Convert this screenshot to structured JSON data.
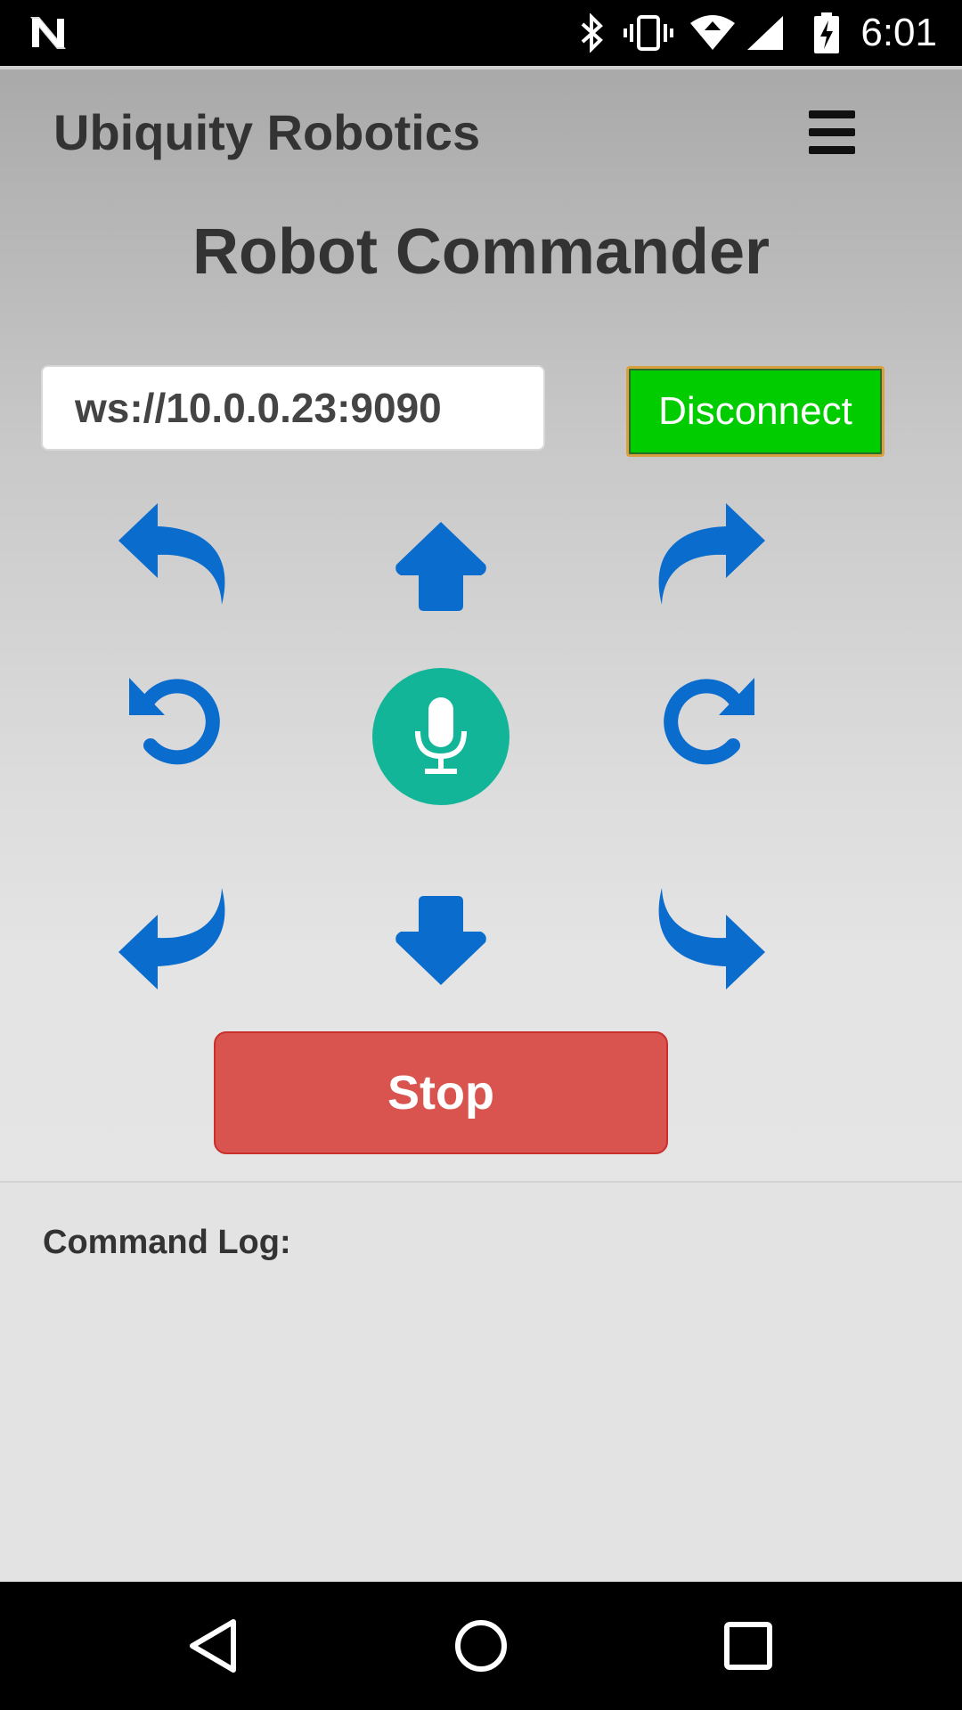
{
  "status_bar": {
    "time": "6:01",
    "icons": [
      "n-icon",
      "bluetooth-icon",
      "vibrate-icon",
      "wifi-icon",
      "signal-icon",
      "battery-charging-icon"
    ]
  },
  "header": {
    "brand": "Ubiquity Robotics",
    "menu_icon": "hamburger-menu-icon"
  },
  "main": {
    "title": "Robot Commander",
    "connection": {
      "url_value": "ws://10.0.0.23:9090",
      "button_label": "Disconnect"
    },
    "controls": [
      {
        "name": "forward-left",
        "icon": "curved-arrow-up-left-icon"
      },
      {
        "name": "forward",
        "icon": "arrow-up-icon"
      },
      {
        "name": "forward-right",
        "icon": "curved-arrow-up-right-icon"
      },
      {
        "name": "rotate-left",
        "icon": "rotate-ccw-icon"
      },
      {
        "name": "voice",
        "icon": "microphone-icon"
      },
      {
        "name": "rotate-right",
        "icon": "rotate-cw-icon"
      },
      {
        "name": "back-left",
        "icon": "curved-arrow-down-left-icon"
      },
      {
        "name": "back",
        "icon": "arrow-down-icon"
      },
      {
        "name": "back-right",
        "icon": "curved-arrow-down-right-icon"
      }
    ],
    "stop_label": "Stop"
  },
  "log": {
    "label": "Command Log:"
  },
  "colors": {
    "arrow_blue": "#0a6ccd",
    "mic_teal": "#13b598",
    "disconnect_green": "#00cc00",
    "stop_red": "#d9534f"
  },
  "nav_bar": {
    "icons": [
      "back-triangle-icon",
      "home-circle-icon",
      "recents-square-icon"
    ]
  }
}
